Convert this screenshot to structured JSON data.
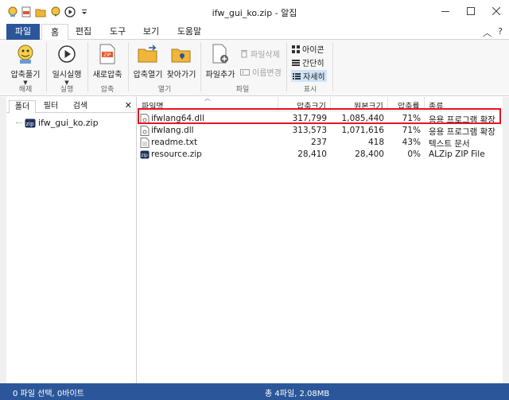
{
  "window": {
    "title": "ifw_gui_ko.zip - 알집",
    "controls": [
      "minimize",
      "maximize",
      "close"
    ]
  },
  "ribbon_tabs": [
    {
      "label": "파일"
    },
    {
      "label": "홈"
    },
    {
      "label": "편집"
    },
    {
      "label": "도구"
    },
    {
      "label": "보기"
    },
    {
      "label": "도움말"
    }
  ],
  "help": {
    "collapse": "︿",
    "question": "?"
  },
  "ribbon": {
    "extract": {
      "label": "압축풀기",
      "group": "해제"
    },
    "pause": {
      "label": "일시실행",
      "group": "실행"
    },
    "new_zip": {
      "label": "새로압축",
      "group": "압축"
    },
    "open_zip": {
      "label": "압축열기"
    },
    "find": {
      "label": "찾아가기"
    },
    "open_group": "열기",
    "add_file": {
      "label": "파일추가"
    },
    "delete_file": {
      "label": "파일삭제"
    },
    "rename": {
      "label": "이름변경"
    },
    "file_group": "파일",
    "view_icons": {
      "label": "아이콘"
    },
    "view_simple": {
      "label": "간단히"
    },
    "view_detail": {
      "label": "자세히"
    },
    "view_group": "표시"
  },
  "left_panel": {
    "tabs": [
      "폴더",
      "필터",
      "검색"
    ],
    "close": "✕",
    "tree_item": "ifw_gui_ko.zip"
  },
  "list": {
    "columns": [
      "파일명",
      "압축크기",
      "원본크기",
      "압축률",
      "종류"
    ],
    "rows": [
      {
        "name": "ifwlang64.dll",
        "compressed": "317,799",
        "original": "1,085,440",
        "ratio": "71%",
        "type": "응용 프로그램 확장",
        "icon": "dll-file-icon"
      },
      {
        "name": "ifwlang.dll",
        "compressed": "313,573",
        "original": "1,071,616",
        "ratio": "71%",
        "type": "응용 프로그램 확장",
        "icon": "dll-file-icon"
      },
      {
        "name": "readme.txt",
        "compressed": "237",
        "original": "418",
        "ratio": "43%",
        "type": "텍스트 문서",
        "icon": "text-file-icon"
      },
      {
        "name": "resource.zip",
        "compressed": "28,410",
        "original": "28,400",
        "ratio": "0%",
        "type": "ALZip ZIP File",
        "icon": "zip-file-icon"
      }
    ]
  },
  "statusbar": {
    "left": "0 파일 선택, 0바이트",
    "center": "총 4파일, 2.08MB"
  },
  "colors": {
    "accent": "#2b579a",
    "highlight": "#e8121f"
  }
}
